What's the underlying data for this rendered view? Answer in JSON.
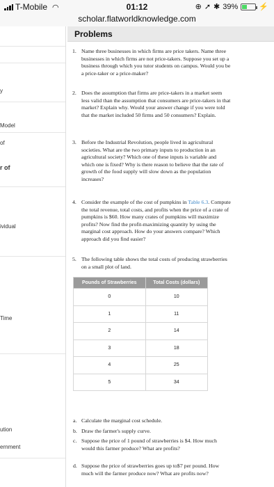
{
  "status_bar": {
    "carrier": "T-Mobile",
    "time": "01:12",
    "battery": "39%"
  },
  "browser": {
    "url": "scholar.flatworldknowledge.com"
  },
  "left_page": {
    "fragments": [
      "y",
      "Model",
      "of",
      "r of",
      "ividual",
      "Time",
      "ution",
      "ernment"
    ]
  },
  "panel": {
    "title": "Problems",
    "questions": [
      {
        "num": "1.",
        "text": "Name three businesses in which firms are price takers. Name three businesses in which firms are not price-takers. Suppose you set up a business through which you tutor students on campus. Would you be a price-taker or a price-maker?"
      },
      {
        "num": "2.",
        "text": "Does the assumption that firms are price-takers in a market seem less valid than the assumption that consumers are price-takers in that market? Explain why. Would your answer change if you were told that the market included 50 firms and 50 consumers? Explain."
      },
      {
        "num": "3.",
        "text": "Before the Industrial Revolution, people lived in agricultural societies. What are the two primary inputs to production in an agricultural society? Which one of these inputs is variable and which one is fixed? Why is there reason to believe that the rate of growth of the food supply will slow down as the population increases?"
      },
      {
        "num": "4.",
        "text_before": "Consider the example of the cost of pumpkins in ",
        "link": "Table 6.3",
        "text_after": ". Compute the total revenue, total costs, and profits when the price of a crate of pumpkins is $60. How many crates of pumpkins will maximize profits? Now find the profit-maximizing quantity by using the marginal cost approach. How do your answers compare? Which approach did you find easier?"
      },
      {
        "num": "5.",
        "text": "The following table shows the total costs of producing strawberries on a small plot of land."
      }
    ],
    "table": {
      "headers": [
        "Pounds of Strawberries",
        "Total Costs (dollars)"
      ],
      "rows": [
        [
          "0",
          "10"
        ],
        [
          "1",
          "11"
        ],
        [
          "2",
          "14"
        ],
        [
          "3",
          "18"
        ],
        [
          "4",
          "25"
        ],
        [
          "5",
          "34"
        ]
      ]
    },
    "sub_questions": [
      {
        "num": "a.",
        "text": "Calculate the marginal cost schedule."
      },
      {
        "num": "b.",
        "text": "Draw the farmer's supply curve."
      },
      {
        "num": "c.",
        "text": "Suppose the price of 1 pound of strawberries is $4. How much would this farmer produce? What are profits?"
      },
      {
        "num": "d.",
        "text": "Suppose the price of strawberries goes up to$7 per pound. How much will the farmer produce now? What are profits now?"
      }
    ]
  }
}
